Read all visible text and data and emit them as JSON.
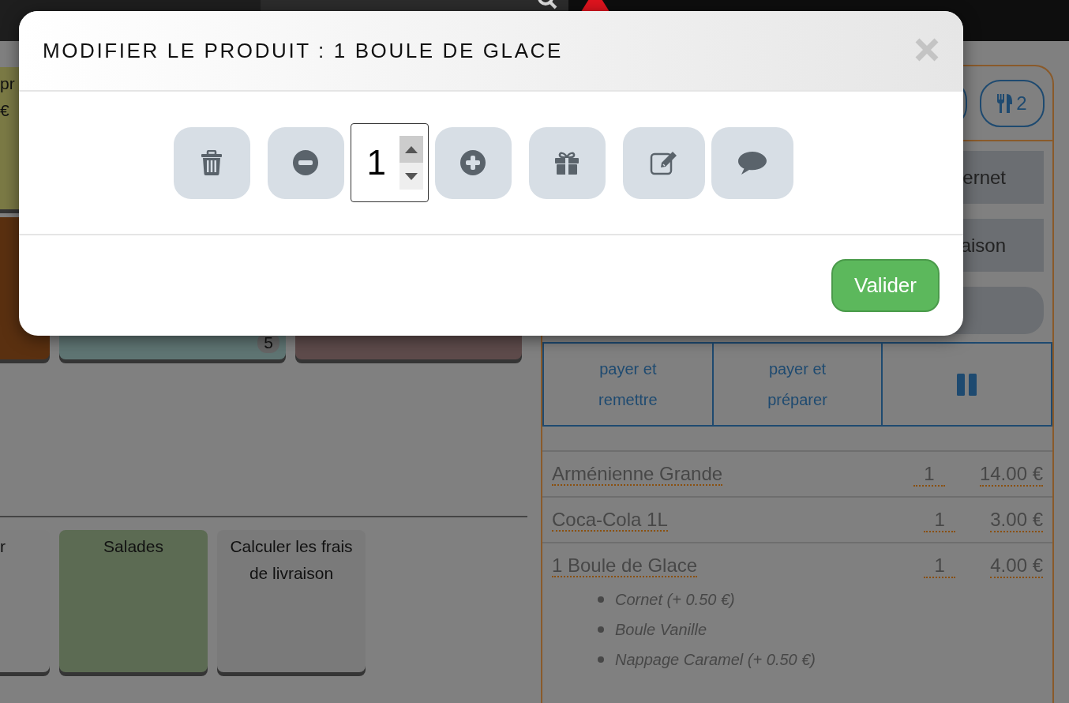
{
  "product_tile_rows": [
    {
      "tiles": [
        {
          "color": "#7b7a45",
          "lines": [
            "pr",
            "€"
          ]
        }
      ]
    },
    {
      "tiles": [
        {
          "color": "#5a3010"
        },
        {
          "color": "#5f7573",
          "badge": "5"
        },
        {
          "color": "#5e4b4b"
        }
      ]
    }
  ],
  "category_tiles": [
    {
      "color": "#7f7f7f",
      "lines": [
        "r"
      ]
    },
    {
      "color": "#5c6b53",
      "lines": [
        "Salades"
      ]
    },
    {
      "color": "#7a7a7a",
      "lines": [
        "Calculer les frais de livraison"
      ]
    }
  ],
  "order_panel": {
    "header_buttons": [
      {
        "kind": "plain"
      },
      {
        "kind": "covers",
        "label": "2"
      }
    ],
    "mode_buttons": [
      {
        "kind": "text",
        "label": "ernet"
      },
      {
        "kind": "text",
        "label": "aison"
      },
      {
        "kind": "empty"
      }
    ],
    "pay_buttons": [
      {
        "kind": "text",
        "label": "payer et remettre"
      },
      {
        "kind": "text",
        "label": "payer et préparer"
      },
      {
        "kind": "pause"
      }
    ],
    "lines": [
      {
        "name": "Arménienne Grande",
        "qty": "1",
        "price": "14.00 €"
      },
      {
        "name": "Coca-Cola 1L",
        "qty": "1",
        "price": "3.00 €"
      },
      {
        "name": "1 Boule de Glace",
        "qty": "1",
        "price": "4.00 €",
        "options": [
          "Cornet (+ 0.50 €)",
          "Boule Vanille",
          "Nappage Caramel (+ 0.50 €)"
        ]
      }
    ]
  },
  "modal": {
    "title": "MODIFIER LE PRODUIT : 1 BOULE DE GLACE",
    "actions": [
      {
        "kind": "delete"
      },
      {
        "kind": "decrease"
      },
      {
        "kind": "quantity",
        "value": "1"
      },
      {
        "kind": "increase"
      },
      {
        "kind": "gift"
      },
      {
        "kind": "edit"
      },
      {
        "kind": "comment"
      }
    ],
    "confirm": "Valider"
  }
}
